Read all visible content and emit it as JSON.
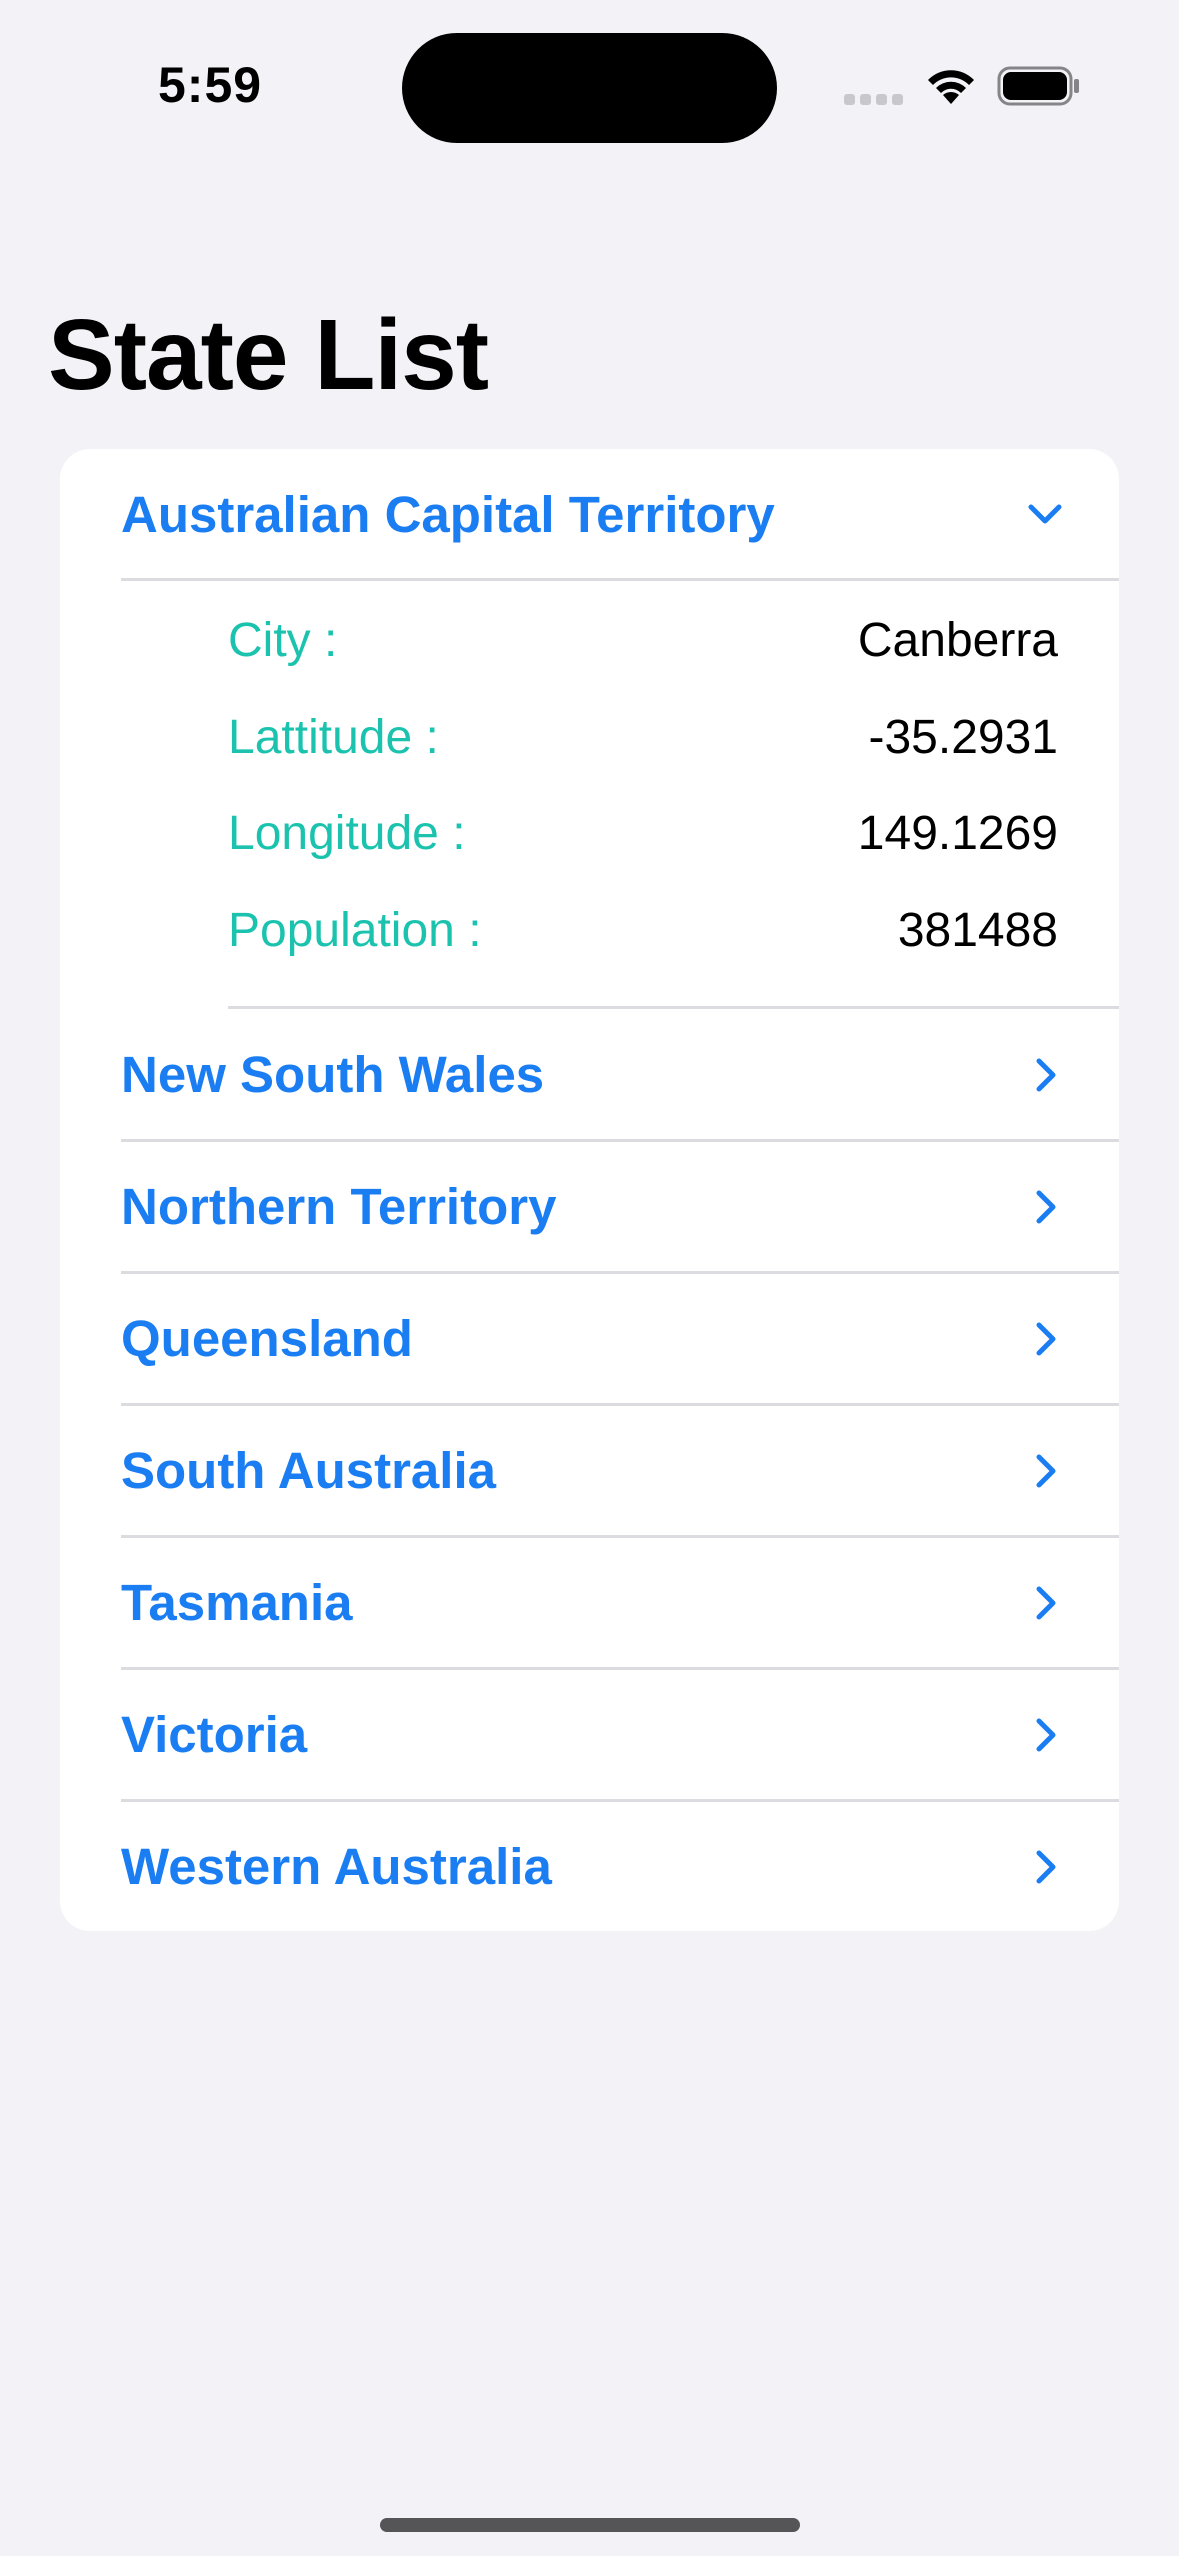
{
  "status_bar": {
    "time": "5:59"
  },
  "title": "State List",
  "states": [
    {
      "name": "Australian Capital Territory",
      "expanded": true,
      "chevron": "chevron-down-icon",
      "details": [
        {
          "key": "City :",
          "value": "Canberra"
        },
        {
          "key": "Lattitude :",
          "value": "-35.2931"
        },
        {
          "key": "Longitude :",
          "value": "149.1269"
        },
        {
          "key": "Population :",
          "value": "381488"
        }
      ]
    },
    {
      "name": "New South Wales",
      "expanded": false,
      "chevron": "chevron-right-icon"
    },
    {
      "name": "Northern Territory",
      "expanded": false,
      "chevron": "chevron-right-icon"
    },
    {
      "name": "Queensland",
      "expanded": false,
      "chevron": "chevron-right-icon"
    },
    {
      "name": "South Australia",
      "expanded": false,
      "chevron": "chevron-right-icon"
    },
    {
      "name": "Tasmania",
      "expanded": false,
      "chevron": "chevron-right-icon"
    },
    {
      "name": "Victoria",
      "expanded": false,
      "chevron": "chevron-right-icon"
    },
    {
      "name": "Western Australia",
      "expanded": false,
      "chevron": "chevron-right-icon"
    }
  ],
  "colors": {
    "background": "#F2F2F7",
    "accent": "#1A7DF2",
    "detail_key": "#1BC3AE"
  }
}
